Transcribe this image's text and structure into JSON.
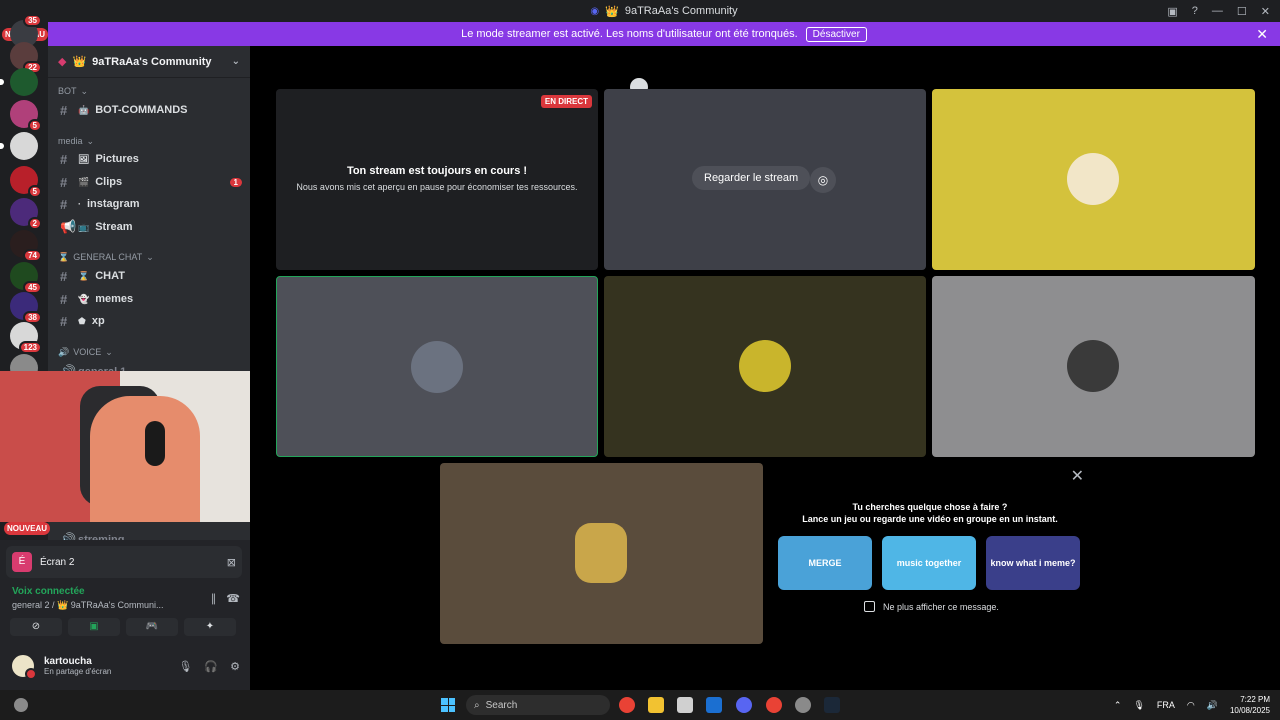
{
  "window": {
    "title": "9aTRaAa's Community",
    "title_icon": "crown-icon"
  },
  "banner": {
    "message": "Le mode streamer est activé. Les noms d'utilisateur ont été tronqués.",
    "button": "Désactiver"
  },
  "servers": {
    "new_label": "NOUVEAU",
    "badges": [
      "35",
      "22",
      "5",
      "5",
      "2",
      "74",
      "45",
      "38",
      "123"
    ]
  },
  "guild": {
    "name": "9aTRaAa's Community"
  },
  "channels": {
    "cat_bot": "BOT",
    "bot_commands": "BOT-COMMANDS",
    "cat_media": "media",
    "pictures": "Pictures",
    "clips": "Clips",
    "clips_unread": "1",
    "instagram": "instagram",
    "stream": "Stream",
    "cat_general": "GENERAL CHAT",
    "chat": "CHAT",
    "memes": "memes",
    "xp": "xp",
    "cat_voice": "VOICE",
    "voice_partial": "general 1",
    "streaming_partial": "streming",
    "new_label": "NOUVEAU"
  },
  "voice_panel": {
    "screen_label": "Écran 2",
    "status": "Voix connectée",
    "channel": "general 2 / 👑 9aTRaAa's Communi...",
    "user_name": "kartoucha",
    "user_status": "En partage d'écran"
  },
  "stage": {
    "live_label": "EN DIRECT",
    "paused_title": "Ton stream est toujours en cours !",
    "paused_text": "Nous avons mis cet aperçu en pause pour économiser tes ressources.",
    "watch_button": "Regarder le stream"
  },
  "activity": {
    "line1": "Tu cherches quelque chose à faire ?",
    "line2": "Lance un jeu ou regarde une vidéo en groupe en un instant.",
    "card1": "MERGE",
    "card2": "music together",
    "card3": "know what i meme?",
    "dont_show": "Ne plus afficher ce message."
  },
  "taskbar": {
    "search_placeholder": "Search",
    "lang": "FRA",
    "time": "7:22 PM",
    "date": "10/08/2025"
  }
}
